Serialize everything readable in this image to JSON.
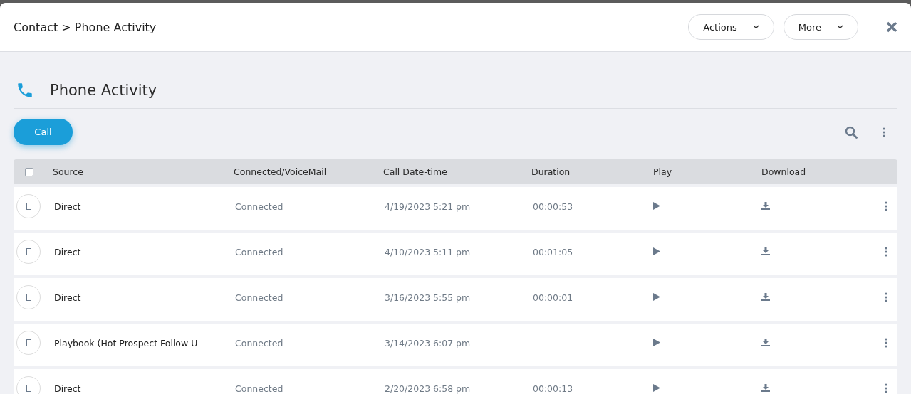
{
  "header": {
    "breadcrumb": "Contact > Phone Activity",
    "buttons": [
      {
        "label": "Actions"
      },
      {
        "label": "More"
      }
    ]
  },
  "section": {
    "title": "Phone Activity",
    "call_button": "Call"
  },
  "table": {
    "select_all": {
      "checked": false
    },
    "columns": [
      "Source",
      "Connected/VoiceMail",
      "Call Date-time",
      "Duration",
      "Play",
      "Download"
    ],
    "rows": [
      {
        "checked": false,
        "source": "Direct",
        "status": "Connected",
        "datetime": "4/19/2023 5:21 pm",
        "duration": "00:00:53"
      },
      {
        "checked": false,
        "source": "Direct",
        "status": "Connected",
        "datetime": "4/10/2023 5:11 pm",
        "duration": "00:01:05"
      },
      {
        "checked": false,
        "source": "Direct",
        "status": "Connected",
        "datetime": "3/16/2023 5:55 pm",
        "duration": "00:00:01"
      },
      {
        "checked": false,
        "source": "Playbook (Hot Prospect Follow U",
        "status": "Connected",
        "datetime": "3/14/2023 6:07 pm"
      },
      {
        "checked": false,
        "source": "Direct",
        "status": "Connected",
        "datetime": "2/20/2023 6:58 pm",
        "duration": "00:00:13"
      }
    ]
  }
}
